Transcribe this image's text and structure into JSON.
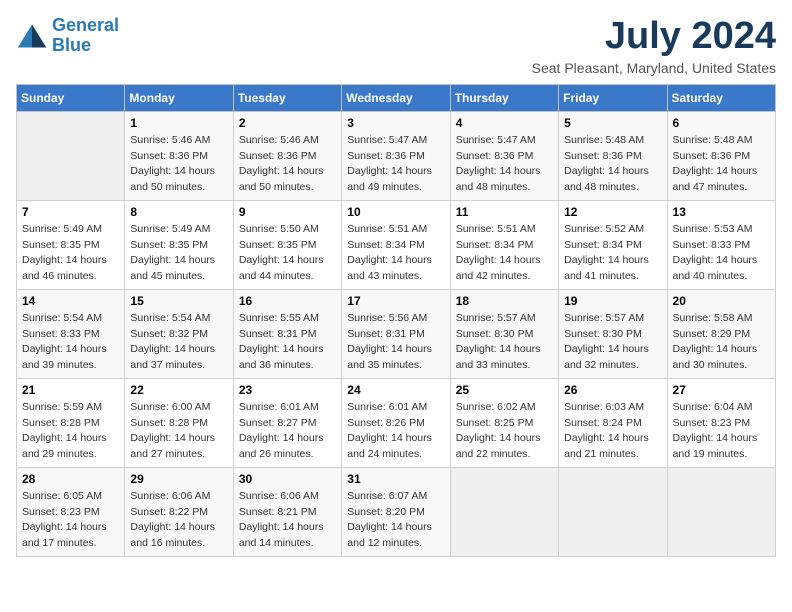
{
  "logo": {
    "line1": "General",
    "line2": "Blue"
  },
  "title": "July 2024",
  "location": "Seat Pleasant, Maryland, United States",
  "days_header": [
    "Sunday",
    "Monday",
    "Tuesday",
    "Wednesday",
    "Thursday",
    "Friday",
    "Saturday"
  ],
  "weeks": [
    [
      {
        "num": "",
        "info": ""
      },
      {
        "num": "1",
        "info": "Sunrise: 5:46 AM\nSunset: 8:36 PM\nDaylight: 14 hours\nand 50 minutes."
      },
      {
        "num": "2",
        "info": "Sunrise: 5:46 AM\nSunset: 8:36 PM\nDaylight: 14 hours\nand 50 minutes."
      },
      {
        "num": "3",
        "info": "Sunrise: 5:47 AM\nSunset: 8:36 PM\nDaylight: 14 hours\nand 49 minutes."
      },
      {
        "num": "4",
        "info": "Sunrise: 5:47 AM\nSunset: 8:36 PM\nDaylight: 14 hours\nand 48 minutes."
      },
      {
        "num": "5",
        "info": "Sunrise: 5:48 AM\nSunset: 8:36 PM\nDaylight: 14 hours\nand 48 minutes."
      },
      {
        "num": "6",
        "info": "Sunrise: 5:48 AM\nSunset: 8:36 PM\nDaylight: 14 hours\nand 47 minutes."
      }
    ],
    [
      {
        "num": "7",
        "info": "Sunrise: 5:49 AM\nSunset: 8:35 PM\nDaylight: 14 hours\nand 46 minutes."
      },
      {
        "num": "8",
        "info": "Sunrise: 5:49 AM\nSunset: 8:35 PM\nDaylight: 14 hours\nand 45 minutes."
      },
      {
        "num": "9",
        "info": "Sunrise: 5:50 AM\nSunset: 8:35 PM\nDaylight: 14 hours\nand 44 minutes."
      },
      {
        "num": "10",
        "info": "Sunrise: 5:51 AM\nSunset: 8:34 PM\nDaylight: 14 hours\nand 43 minutes."
      },
      {
        "num": "11",
        "info": "Sunrise: 5:51 AM\nSunset: 8:34 PM\nDaylight: 14 hours\nand 42 minutes."
      },
      {
        "num": "12",
        "info": "Sunrise: 5:52 AM\nSunset: 8:34 PM\nDaylight: 14 hours\nand 41 minutes."
      },
      {
        "num": "13",
        "info": "Sunrise: 5:53 AM\nSunset: 8:33 PM\nDaylight: 14 hours\nand 40 minutes."
      }
    ],
    [
      {
        "num": "14",
        "info": "Sunrise: 5:54 AM\nSunset: 8:33 PM\nDaylight: 14 hours\nand 39 minutes."
      },
      {
        "num": "15",
        "info": "Sunrise: 5:54 AM\nSunset: 8:32 PM\nDaylight: 14 hours\nand 37 minutes."
      },
      {
        "num": "16",
        "info": "Sunrise: 5:55 AM\nSunset: 8:31 PM\nDaylight: 14 hours\nand 36 minutes."
      },
      {
        "num": "17",
        "info": "Sunrise: 5:56 AM\nSunset: 8:31 PM\nDaylight: 14 hours\nand 35 minutes."
      },
      {
        "num": "18",
        "info": "Sunrise: 5:57 AM\nSunset: 8:30 PM\nDaylight: 14 hours\nand 33 minutes."
      },
      {
        "num": "19",
        "info": "Sunrise: 5:57 AM\nSunset: 8:30 PM\nDaylight: 14 hours\nand 32 minutes."
      },
      {
        "num": "20",
        "info": "Sunrise: 5:58 AM\nSunset: 8:29 PM\nDaylight: 14 hours\nand 30 minutes."
      }
    ],
    [
      {
        "num": "21",
        "info": "Sunrise: 5:59 AM\nSunset: 8:28 PM\nDaylight: 14 hours\nand 29 minutes."
      },
      {
        "num": "22",
        "info": "Sunrise: 6:00 AM\nSunset: 8:28 PM\nDaylight: 14 hours\nand 27 minutes."
      },
      {
        "num": "23",
        "info": "Sunrise: 6:01 AM\nSunset: 8:27 PM\nDaylight: 14 hours\nand 26 minutes."
      },
      {
        "num": "24",
        "info": "Sunrise: 6:01 AM\nSunset: 8:26 PM\nDaylight: 14 hours\nand 24 minutes."
      },
      {
        "num": "25",
        "info": "Sunrise: 6:02 AM\nSunset: 8:25 PM\nDaylight: 14 hours\nand 22 minutes."
      },
      {
        "num": "26",
        "info": "Sunrise: 6:03 AM\nSunset: 8:24 PM\nDaylight: 14 hours\nand 21 minutes."
      },
      {
        "num": "27",
        "info": "Sunrise: 6:04 AM\nSunset: 8:23 PM\nDaylight: 14 hours\nand 19 minutes."
      }
    ],
    [
      {
        "num": "28",
        "info": "Sunrise: 6:05 AM\nSunset: 8:23 PM\nDaylight: 14 hours\nand 17 minutes."
      },
      {
        "num": "29",
        "info": "Sunrise: 6:06 AM\nSunset: 8:22 PM\nDaylight: 14 hours\nand 16 minutes."
      },
      {
        "num": "30",
        "info": "Sunrise: 6:06 AM\nSunset: 8:21 PM\nDaylight: 14 hours\nand 14 minutes."
      },
      {
        "num": "31",
        "info": "Sunrise: 6:07 AM\nSunset: 8:20 PM\nDaylight: 14 hours\nand 12 minutes."
      },
      {
        "num": "",
        "info": ""
      },
      {
        "num": "",
        "info": ""
      },
      {
        "num": "",
        "info": ""
      }
    ]
  ]
}
